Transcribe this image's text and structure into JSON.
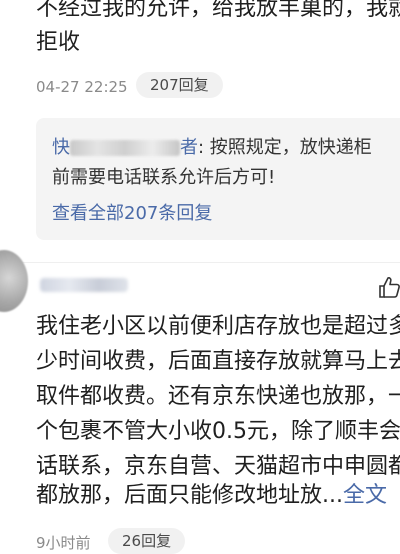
{
  "comment1": {
    "lines": [
      "不经过我的允许，给我放丰巢的，我就",
      "拒收"
    ],
    "time": "04-27 22:25",
    "reply_count": "207回复",
    "reply_preview": {
      "user_start": "快",
      "user_end": "者",
      "line1_text": ": 按照规定，放快递柜",
      "line2_text": "前需要电话联系允许后方可!"
    },
    "view_all": "查看全部207条回复"
  },
  "comment2": {
    "lines": [
      "我住老小区以前便利店存放也是超过多",
      "少时间收费，后面直接存放就算马上去",
      "取件都收费。还有京东快递也放那，一",
      "个包裹不管大小收0.5元，除了顺丰会",
      "话联系，京东自营、天猫超市中申圆都",
      "都放那，后面只能修改地址放..."
    ],
    "expand": "全文",
    "time": "9小时前",
    "reply_count": "26回复"
  },
  "colors": {
    "link": "#4a6aa8",
    "meta": "#8a8a8a",
    "reply_bg": "#f4f4f4",
    "pill_bg": "#f1f1f1"
  },
  "icons": {
    "like": "thumbs-up-icon"
  }
}
